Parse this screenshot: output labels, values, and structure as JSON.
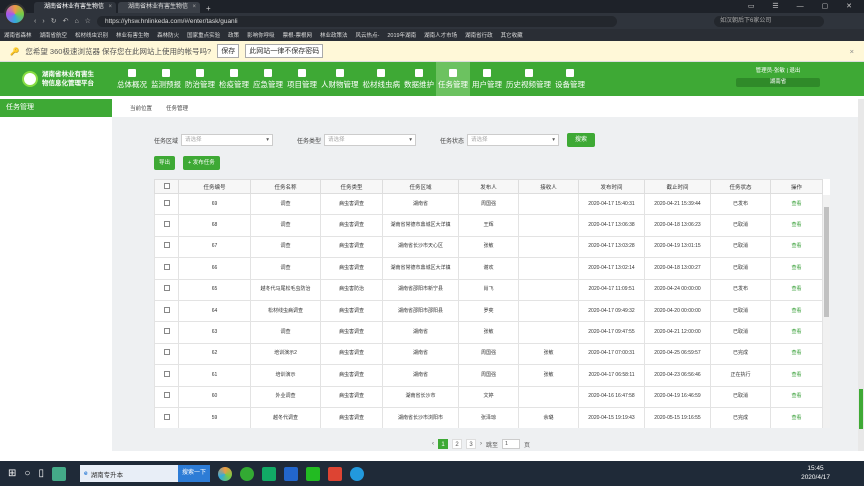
{
  "browser": {
    "tabs": [
      {
        "label": "湖南省林业有害生物信"
      },
      {
        "label": "湖南省林业有害生物信"
      }
    ],
    "url": "https://yhsw.hnlinkeda.com/#/enter/task/guanli",
    "search_placeholder": "如汉朝后下6家公司",
    "bookmarks": [
      "湖南省森林",
      "湖南省航空",
      "松材线虫识别",
      "林业有害生物",
      "森林防火",
      "国家重点实验",
      "政策",
      "影响你呼吸",
      "票根-票根网",
      "林业政策法",
      "风云热点-",
      "2019年湖南",
      "湖南人才市场",
      "湖南省行政",
      "其它收藏"
    ],
    "password_bar": {
      "message": "您希望 360极速浏览器 保存您在此网站上使用的帐号吗?",
      "save_label": "保存",
      "never_label": "此网站一律不保存密码"
    }
  },
  "app": {
    "brand_line1": "湖南省林业有害生",
    "brand_line2": "物信息化管理平台",
    "menu": [
      {
        "label": "总体概况",
        "icon": "home-icon"
      },
      {
        "label": "监测预报",
        "icon": "shield-icon"
      },
      {
        "label": "防治管理",
        "icon": "plus-icon"
      },
      {
        "label": "检疫管理",
        "icon": "clipboard-icon"
      },
      {
        "label": "应急管理",
        "icon": "bank-icon"
      },
      {
        "label": "项目管理",
        "icon": "grid-icon"
      },
      {
        "label": "人财物管理",
        "icon": "person-icon"
      },
      {
        "label": "松材线虫病",
        "icon": "bug-icon"
      },
      {
        "label": "数据维护",
        "icon": "bar-chart-icon"
      },
      {
        "label": "任务管理",
        "icon": "task-icon",
        "active": true
      },
      {
        "label": "用户管理",
        "icon": "user-icon"
      },
      {
        "label": "历史视频管理",
        "icon": "video-icon"
      },
      {
        "label": "设备管理",
        "icon": "device-icon"
      }
    ],
    "user": {
      "text": "管理员-张敏 | 退出",
      "region": "湖南省"
    },
    "side_title": "任务管理"
  },
  "breadcrumb": {
    "label": "当前位置",
    "current": "任务管理"
  },
  "filters": {
    "area_label": "任务区域",
    "area_placeholder": "请选择",
    "type_label": "任务类型",
    "type_placeholder": "请选择",
    "status_label": "任务状态",
    "status_placeholder": "请选择",
    "search_label": "搜索"
  },
  "actions": {
    "export_label": "导出",
    "publish_label": "+ 发布任务"
  },
  "table": {
    "headers": [
      "任务编号",
      "任务名称",
      "任务类型",
      "任务区域",
      "发布人",
      "接收人",
      "发布时间",
      "截止时间",
      "任务状态",
      "操作"
    ],
    "rows": [
      {
        "id": "69",
        "name": "调查",
        "type": "病虫害调查",
        "area": "湖南省",
        "publisher": "周国强",
        "receiver": "",
        "pub_time": "2020-04-17 15:40:31",
        "deadline": "2020-04-21 15:39:44",
        "status": "已发布",
        "op": "查看"
      },
      {
        "id": "68",
        "name": "调查",
        "type": "病虫害调查",
        "area": "湖南省常德市鼎城区大洋镇",
        "publisher": "王辉",
        "receiver": "",
        "pub_time": "2020-04-17 13:06:38",
        "deadline": "2020-04-18 13:06:23",
        "status": "已取消",
        "op": "查看"
      },
      {
        "id": "67",
        "name": "调查",
        "type": "病虫害调查",
        "area": "湖南省长沙市天心区",
        "publisher": "张敏",
        "receiver": "",
        "pub_time": "2020-04-17 13:03:28",
        "deadline": "2020-04-19 13:01:15",
        "status": "已取消",
        "op": "查看"
      },
      {
        "id": "66",
        "name": "调查",
        "type": "病虫害调查",
        "area": "湖南省常德市鼎城区大洋镇",
        "publisher": "谢欢",
        "receiver": "",
        "pub_time": "2020-04-17 13:02:14",
        "deadline": "2020-04-18 13:00:27",
        "status": "已取消",
        "op": "查看"
      },
      {
        "id": "65",
        "name": "越冬代马尾松毛虫防治",
        "type": "病虫害防治",
        "area": "湖南省邵阳市新宁县",
        "publisher": "肖飞",
        "receiver": "",
        "pub_time": "2020-04-17 11:09:51",
        "deadline": "2020-04-24 00:00:00",
        "status": "已发布",
        "op": "查看"
      },
      {
        "id": "64",
        "name": "松材线虫病调查",
        "type": "病虫害调查",
        "area": "湖南省邵阳市邵阳县",
        "publisher": "罗奕",
        "receiver": "",
        "pub_time": "2020-04-17 09:49:32",
        "deadline": "2020-04-20 00:00:00",
        "status": "已取消",
        "op": "查看"
      },
      {
        "id": "63",
        "name": "调查",
        "type": "病虫害调查",
        "area": "湖南省",
        "publisher": "张敏",
        "receiver": "",
        "pub_time": "2020-04-17 09:47:55",
        "deadline": "2020-04-21 12:00:00",
        "status": "已取消",
        "op": "查看"
      },
      {
        "id": "62",
        "name": "培训演示2",
        "type": "病虫害调查",
        "area": "湖南省",
        "publisher": "周国强",
        "receiver": "张敏",
        "pub_time": "2020-04-17 07:00:31",
        "deadline": "2020-04-25 06:59:57",
        "status": "已完成",
        "op": "查看"
      },
      {
        "id": "61",
        "name": "培训演示",
        "type": "病虫害调查",
        "area": "湖南省",
        "publisher": "周国强",
        "receiver": "张敏",
        "pub_time": "2020-04-17 06:58:11",
        "deadline": "2020-04-23 06:56:46",
        "status": "正在执行",
        "op": "查看"
      },
      {
        "id": "60",
        "name": "外业调查",
        "type": "病虫害调查",
        "area": "湖南省长沙市",
        "publisher": "文婷",
        "receiver": "",
        "pub_time": "2020-04-16 16:47:58",
        "deadline": "2020-04-19 16:46:59",
        "status": "已取消",
        "op": "查看"
      },
      {
        "id": "59",
        "name": "越冬代调查",
        "type": "病虫害调查",
        "area": "湖南省长沙市浏阳市",
        "publisher": "张泽琼",
        "receiver": "余璐",
        "pub_time": "2020-04-15 19:19:43",
        "deadline": "2020-05-15 19:16:55",
        "status": "已完成",
        "op": "查看"
      }
    ]
  },
  "pager": {
    "pages": [
      "1",
      "2",
      "3"
    ],
    "current": "1",
    "goto_label": "跳至",
    "goto_value": "1",
    "page_suffix": "页"
  },
  "taskbar": {
    "edit_text": "湖南专升本",
    "search_btn": "搜索一下",
    "time": "15:45",
    "date": "2020/4/17"
  },
  "colors": {
    "brand_green": "#3ea935",
    "active_menu": "#6cc260"
  }
}
